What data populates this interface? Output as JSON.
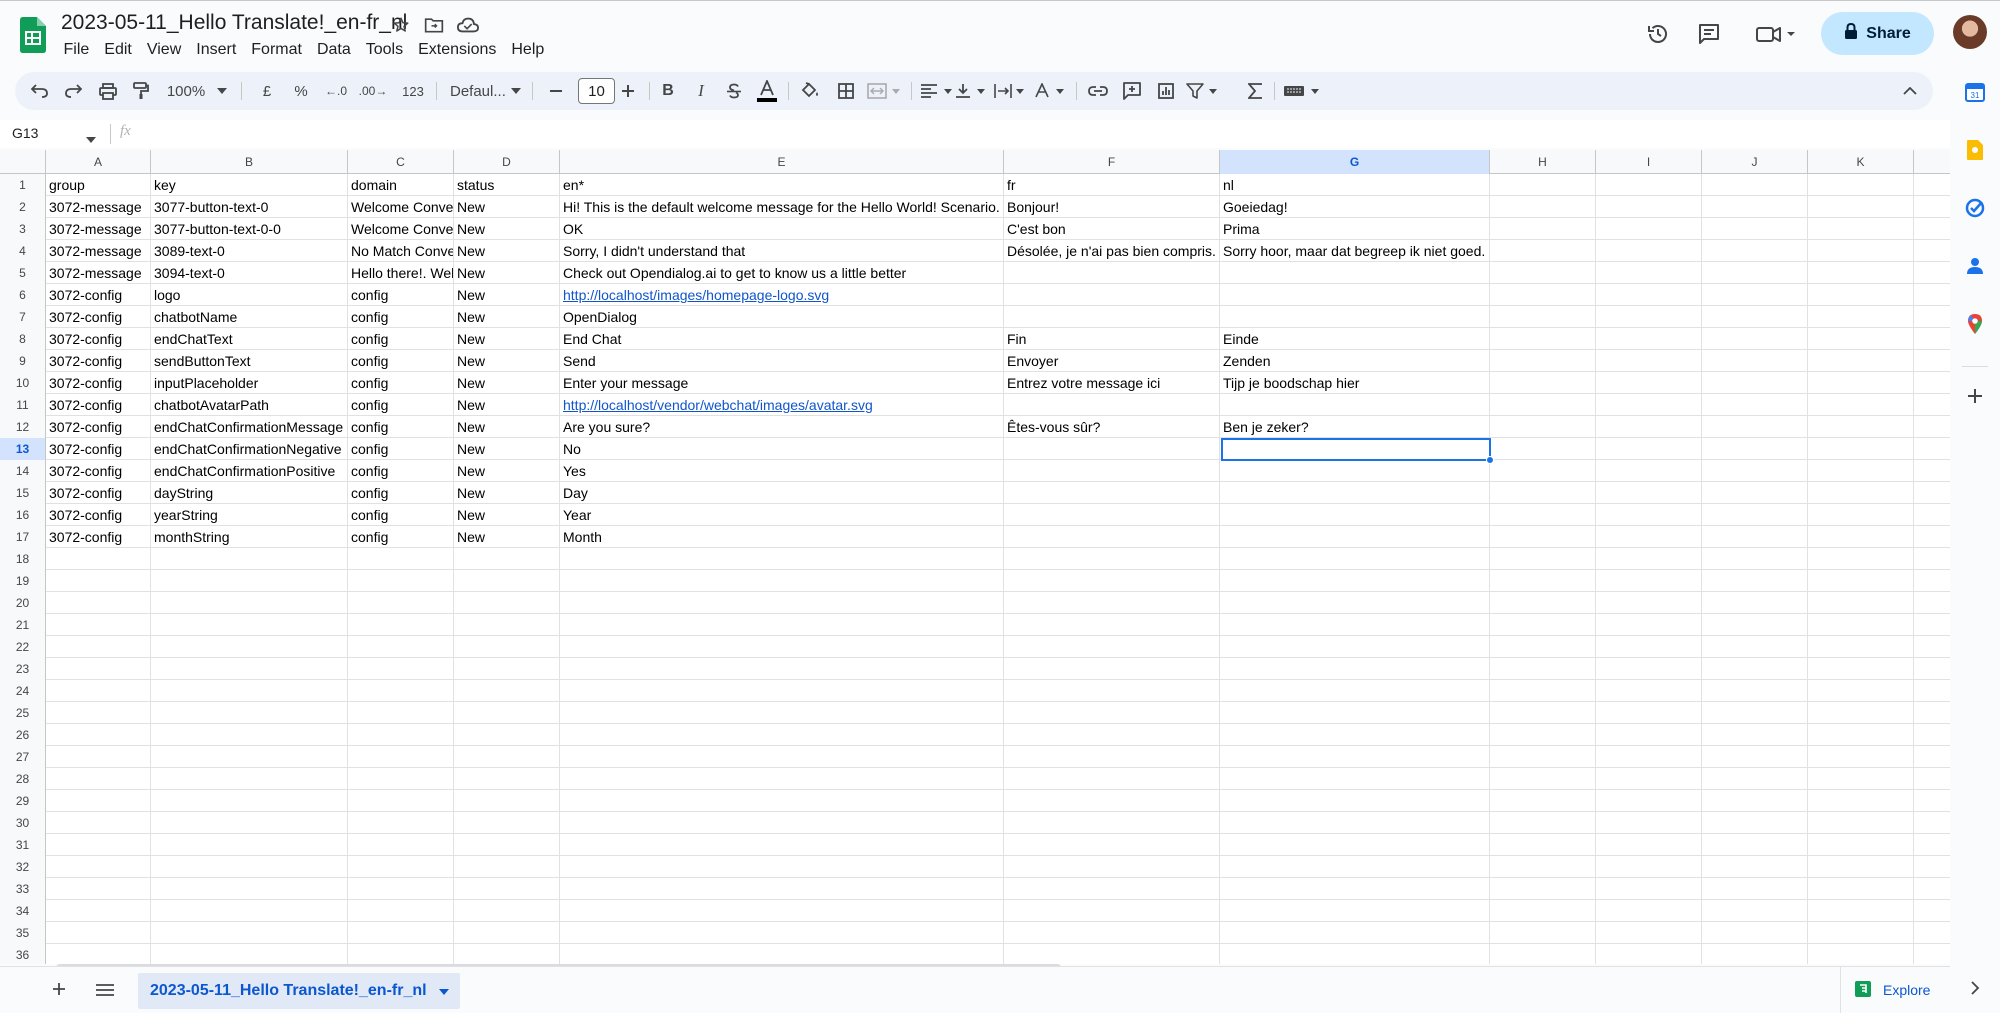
{
  "doc": {
    "title": "2023-05-11_Hello Translate!_en-fr_nl",
    "menu": [
      "File",
      "Edit",
      "View",
      "Insert",
      "Format",
      "Data",
      "Tools",
      "Extensions",
      "Help"
    ],
    "share_label": "Share"
  },
  "toolbar": {
    "zoom": "100%",
    "currency": "£",
    "percent": "%",
    "dec_decrease": ".0",
    "dec_increase": ".00",
    "number_format": "123",
    "font": "Defaul...",
    "font_size": "10",
    "bold": "B",
    "italic": "I"
  },
  "formula_bar": {
    "name_box": "G13",
    "fx": "fx",
    "value": ""
  },
  "columns": [
    "A",
    "B",
    "C",
    "D",
    "E",
    "F",
    "G",
    "H",
    "I",
    "J",
    "K"
  ],
  "selected_column": "G",
  "selected_row": 13,
  "rows": [
    {
      "n": "1",
      "cells": [
        "group",
        "key",
        "domain",
        "status",
        "en*",
        "fr",
        "nl"
      ]
    },
    {
      "n": "2",
      "cells": [
        "3072-message",
        "3077-button-text-0",
        "Welcome Conve",
        "New",
        "Hi! This is the default welcome message for the Hello World! Scenario.",
        "Bonjour!",
        "Goeiedag!"
      ]
    },
    {
      "n": "3",
      "cells": [
        "3072-message",
        "3077-button-text-0-0",
        "Welcome Conve",
        "New",
        "OK",
        "C'est bon",
        "Prima"
      ]
    },
    {
      "n": "4",
      "cells": [
        "3072-message",
        "3089-text-0",
        "No Match Conve",
        "New",
        "Sorry, I didn't understand that",
        "Désolée, je n'ai pas bien compris.",
        "Sorry hoor, maar dat begreep ik niet goed."
      ]
    },
    {
      "n": "5",
      "cells": [
        "3072-message",
        "3094-text-0",
        "Hello there!. Wel",
        "New",
        "Check out Opendialog.ai to get to know us a little better",
        "",
        ""
      ]
    },
    {
      "n": "6",
      "cells": [
        "3072-config",
        "logo",
        "config",
        "New",
        "http://localhost/images/homepage-logo.svg",
        "",
        ""
      ]
    },
    {
      "n": "7",
      "cells": [
        "3072-config",
        "chatbotName",
        "config",
        "New",
        "OpenDialog",
        "",
        ""
      ]
    },
    {
      "n": "8",
      "cells": [
        "3072-config",
        "endChatText",
        "config",
        "New",
        "End Chat",
        "Fin",
        "Einde"
      ]
    },
    {
      "n": "9",
      "cells": [
        "3072-config",
        "sendButtonText",
        "config",
        "New",
        "Send",
        "Envoyer",
        "Zenden"
      ]
    },
    {
      "n": "10",
      "cells": [
        "3072-config",
        "inputPlaceholder",
        "config",
        "New",
        "Enter your message",
        "Entrez votre message ici",
        "Tijp je boodschap hier"
      ]
    },
    {
      "n": "11",
      "cells": [
        "3072-config",
        "chatbotAvatarPath",
        "config",
        "New",
        "http://localhost/vendor/webchat/images/avatar.svg",
        "",
        ""
      ]
    },
    {
      "n": "12",
      "cells": [
        "3072-config",
        "endChatConfirmationMessage",
        "config",
        "New",
        "Are you sure?",
        "Êtes-vous sûr?",
        "Ben je zeker?"
      ]
    },
    {
      "n": "13",
      "cells": [
        "3072-config",
        "endChatConfirmationNegative",
        "config",
        "New",
        "No",
        "",
        ""
      ]
    },
    {
      "n": "14",
      "cells": [
        "3072-config",
        "endChatConfirmationPositive",
        "config",
        "New",
        "Yes",
        "",
        ""
      ]
    },
    {
      "n": "15",
      "cells": [
        "3072-config",
        "dayString",
        "config",
        "New",
        "Day",
        "",
        ""
      ]
    },
    {
      "n": "16",
      "cells": [
        "3072-config",
        "yearString",
        "config",
        "New",
        "Year",
        "",
        ""
      ]
    },
    {
      "n": "17",
      "cells": [
        "3072-config",
        "monthString",
        "config",
        "New",
        "Month",
        "",
        ""
      ]
    },
    {
      "n": "18",
      "cells": []
    },
    {
      "n": "19",
      "cells": []
    },
    {
      "n": "20",
      "cells": []
    },
    {
      "n": "21",
      "cells": []
    },
    {
      "n": "22",
      "cells": []
    },
    {
      "n": "23",
      "cells": []
    },
    {
      "n": "24",
      "cells": []
    },
    {
      "n": "25",
      "cells": []
    },
    {
      "n": "26",
      "cells": []
    },
    {
      "n": "27",
      "cells": []
    },
    {
      "n": "28",
      "cells": []
    },
    {
      "n": "29",
      "cells": []
    },
    {
      "n": "30",
      "cells": []
    },
    {
      "n": "31",
      "cells": []
    },
    {
      "n": "32",
      "cells": []
    },
    {
      "n": "33",
      "cells": []
    },
    {
      "n": "34",
      "cells": []
    },
    {
      "n": "35",
      "cells": []
    },
    {
      "n": "36",
      "cells": []
    }
  ],
  "link_cells": [
    "6:4",
    "11:4"
  ],
  "sheet_tab": "2023-05-11_Hello Translate!_en-fr_nl",
  "explore_label": "Explore",
  "colors": {
    "accent": "#0b57d0",
    "share_bg": "#c2e7ff",
    "selection": "#1a73e8",
    "sheets_green": "#0f9d58"
  }
}
